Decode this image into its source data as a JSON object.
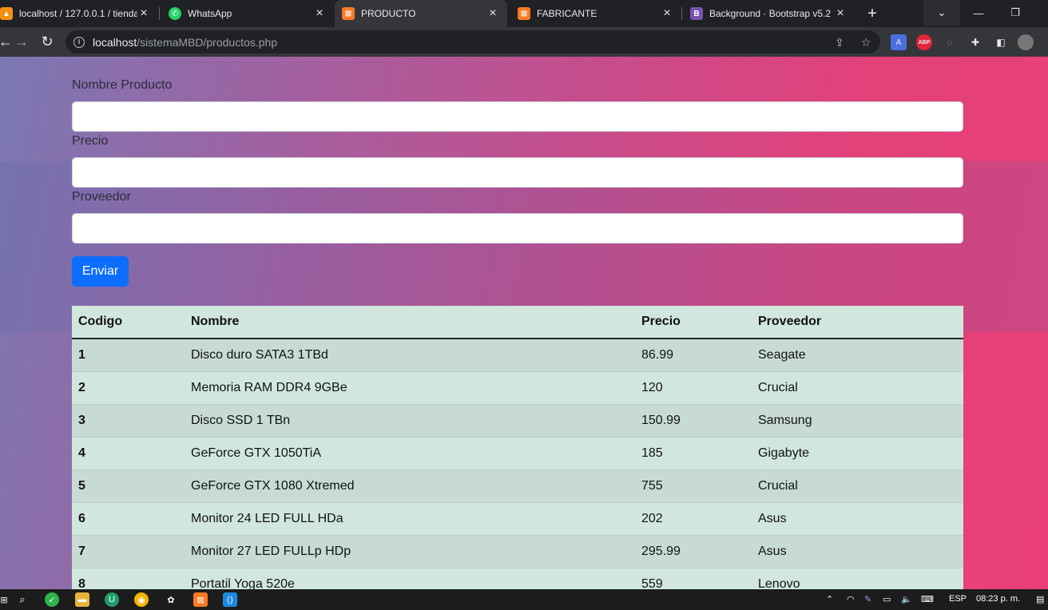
{
  "browser": {
    "tabs": [
      {
        "title": "localhost / 127.0.0.1 / tienda",
        "icon": "phpmyadmin-icon",
        "active": false
      },
      {
        "title": "WhatsApp",
        "icon": "whatsapp-icon",
        "active": false
      },
      {
        "title": "PRODUCTO",
        "icon": "xampp-icon",
        "active": true
      },
      {
        "title": "FABRICANTE",
        "icon": "xampp-icon",
        "active": false
      },
      {
        "title": "Background · Bootstrap v5.2",
        "icon": "bootstrap-icon",
        "active": false
      }
    ],
    "url_host": "localhost",
    "url_path": "/sistemaMBD/productos.php"
  },
  "form": {
    "nombre_label": "Nombre Producto",
    "precio_label": "Precio",
    "proveedor_label": "Proveedor",
    "nombre_value": "",
    "precio_value": "",
    "proveedor_value": "",
    "submit_label": "Enviar"
  },
  "table": {
    "headers": [
      "Codigo",
      "Nombre",
      "Precio",
      "Proveedor"
    ],
    "rows": [
      [
        "1",
        "Disco duro SATA3 1TBd",
        "86.99",
        "Seagate"
      ],
      [
        "2",
        "Memoria RAM DDR4 9GBe",
        "120",
        "Crucial"
      ],
      [
        "3",
        "Disco SSD 1 TBn",
        "150.99",
        "Samsung"
      ],
      [
        "4",
        "GeForce GTX 1050TiA",
        "185",
        "Gigabyte"
      ],
      [
        "5",
        "GeForce GTX 1080 Xtremed",
        "755",
        "Crucial"
      ],
      [
        "6",
        "Monitor 24 LED FULL HDa",
        "202",
        "Asus"
      ],
      [
        "7",
        "Monitor 27 LED FULLp HDp",
        "295.99",
        "Asus"
      ],
      [
        "8",
        "Portatil Yoga 520e",
        "559",
        "Lenovo"
      ]
    ]
  },
  "taskbar": {
    "language": "ESP",
    "time": "08:23 p. m."
  },
  "colors": {
    "accent": "#0d6efd",
    "table_bg": "#d1e7dd",
    "gradient_left": "#7a78b3",
    "gradient_right": "#ea3f79"
  }
}
